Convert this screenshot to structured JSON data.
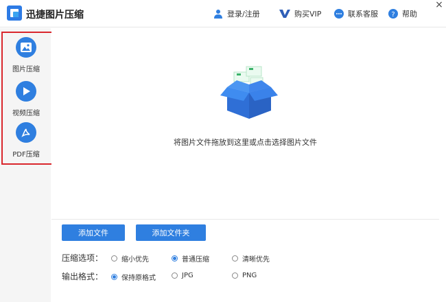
{
  "app": {
    "title": "迅捷图片压缩"
  },
  "header": {
    "login": "登录/注册",
    "vip": "购买VIP",
    "service": "联系客服",
    "help": "帮助",
    "close": "×"
  },
  "sidebar": {
    "items": [
      {
        "label": "图片压缩",
        "icon": "image-icon"
      },
      {
        "label": "视频压缩",
        "icon": "play-icon"
      },
      {
        "label": "PDF压缩",
        "icon": "pdf-icon"
      }
    ]
  },
  "main": {
    "drop_hint": "将图片文件拖放到这里或点击选择图片文件"
  },
  "actions": {
    "add_file": "添加文件",
    "add_folder": "添加文件夹"
  },
  "options": {
    "compress_label": "压缩选项：",
    "compress_options": [
      {
        "label": "缩小优先",
        "checked": false
      },
      {
        "label": "普通压缩",
        "checked": true
      },
      {
        "label": "清晰优先",
        "checked": false
      }
    ],
    "format_label": "输出格式：",
    "format_options": [
      {
        "label": "保持原格式",
        "checked": true
      },
      {
        "label": "JPG",
        "checked": false
      },
      {
        "label": "PNG",
        "checked": false
      }
    ]
  },
  "colors": {
    "accent": "#2f7fe0",
    "highlight": "#d9262c",
    "sidebar_bg": "#f5f5f5"
  }
}
